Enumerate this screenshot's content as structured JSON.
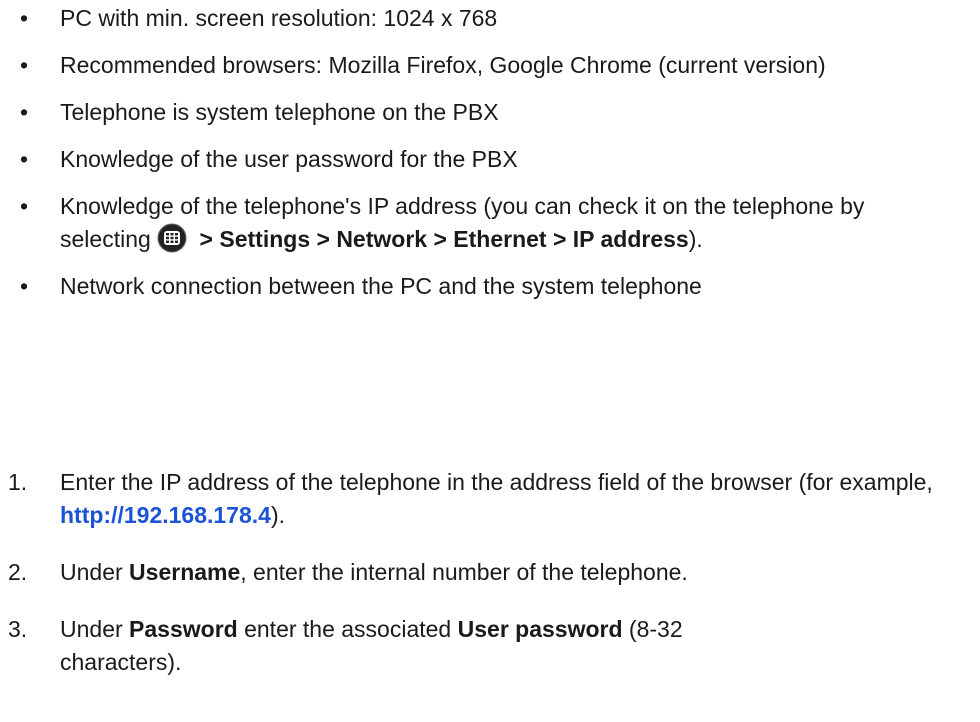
{
  "requirements": [
    {
      "text": "PC with min. screen resolution: 1024 x 768"
    },
    {
      "text": "Recommended browsers: Mozilla Firefox, Google Chrome (current version)"
    },
    {
      "text": "Telephone is system telephone on the PBX"
    },
    {
      "text": "Knowledge of the user password for the PBX"
    },
    {
      "prefix": "Knowledge of the telephone's IP address (you can check it on the telephone by selecting ",
      "icon": "apps-grid-icon",
      "path": " > Settings > Network > Ethernet > IP address",
      "suffix": ")."
    },
    {
      "text": "Network connection between the PC and the system telephone"
    }
  ],
  "steps": [
    {
      "number": "1.",
      "before": "Enter the IP address of the telephone in the address field of the browser (for example, ",
      "link": "http://192.168.178.4",
      "after": ")."
    },
    {
      "number": "2.",
      "before": "Under ",
      "bold": "Username",
      "after": ", enter the internal number of the telephone."
    },
    {
      "number": "3.",
      "before": "Under ",
      "bold": "Password",
      "middle": " enter the associated ",
      "bold2": "User password",
      "after": " (8-32 characters)."
    }
  ],
  "colors": {
    "text": "#1a1a1a",
    "link": "#1a53d6",
    "icon_bg": "#222222"
  }
}
